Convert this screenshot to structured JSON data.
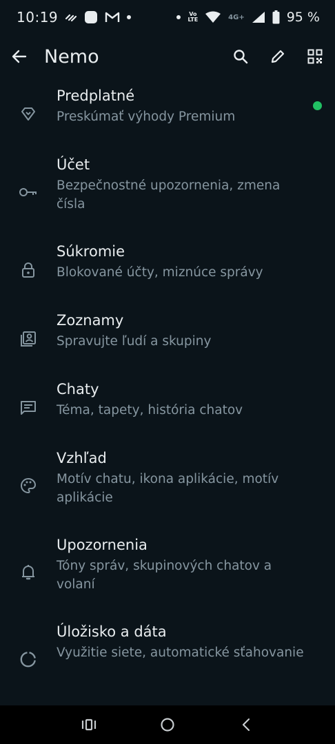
{
  "status_bar": {
    "time": "10:19",
    "volte_top": "Vo",
    "volte_bottom": "LTE",
    "network": "4G+",
    "battery": "95 %"
  },
  "app_bar": {
    "title": "Nemo"
  },
  "settings": [
    {
      "title": "Predplatné",
      "subtitle": "Preskúmať výhody Premium",
      "icon": "premium-diamond-icon",
      "badge": true
    },
    {
      "title": "Účet",
      "subtitle": "Bezpečnostné upozornenia, zmena čísla",
      "icon": "key-icon"
    },
    {
      "title": "Súkromie",
      "subtitle": "Blokované účty, miznúce správy",
      "icon": "lock-icon"
    },
    {
      "title": "Zoznamy",
      "subtitle": "Spravujte ľudí a skupiny",
      "icon": "contacts-list-icon"
    },
    {
      "title": "Chaty",
      "subtitle": "Téma, tapety, história chatov",
      "icon": "chat-icon"
    },
    {
      "title": "Vzhľad",
      "subtitle": "Motív chatu, ikona aplikácie, motív aplikácie",
      "icon": "palette-icon"
    },
    {
      "title": "Upozornenia",
      "subtitle": "Tóny správ, skupinových chatov a volaní",
      "icon": "bell-icon"
    },
    {
      "title": "Úložisko a dáta",
      "subtitle": "Využitie siete, automatické sťahovanie",
      "icon": "storage-icon"
    }
  ],
  "colors": {
    "background": "#0b141a",
    "primary_text": "#e9edef",
    "secondary_text": "#8696a0",
    "accent_green": "#21c063"
  }
}
